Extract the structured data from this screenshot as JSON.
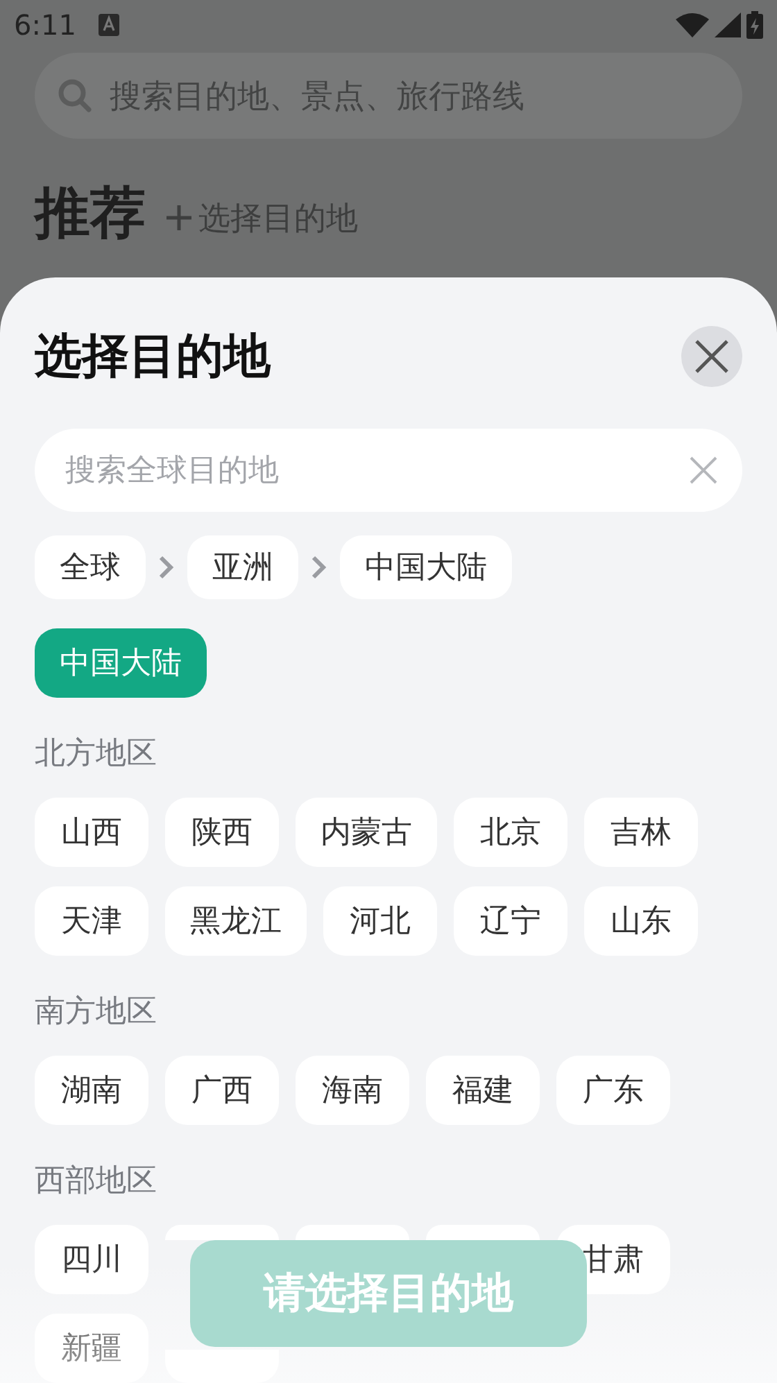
{
  "status_bar": {
    "time": "6:11"
  },
  "background_page": {
    "search": {
      "placeholder": "搜索目的地、景点、旅行路线"
    },
    "title": "推荐",
    "add_link": "选择目的地"
  },
  "sheet": {
    "title": "选择目的地",
    "search": {
      "placeholder": "搜索全球目的地"
    },
    "breadcrumb": [
      "全球",
      "亚洲",
      "中国大陆"
    ],
    "chosen": [
      {
        "label": "中国大陆",
        "selected": true
      }
    ],
    "regions": [
      {
        "title": "北方地区",
        "places": [
          {
            "kind": "place",
            "label": "山西",
            "selected": false
          },
          {
            "kind": "place",
            "label": "陕西",
            "selected": false
          },
          {
            "kind": "place",
            "label": "内蒙古",
            "selected": false
          },
          {
            "kind": "place",
            "label": "北京",
            "selected": false
          },
          {
            "kind": "place",
            "label": "吉林",
            "selected": false
          },
          {
            "kind": "place",
            "label": "天津",
            "selected": false
          },
          {
            "kind": "place",
            "label": "黑龙江",
            "selected": false
          },
          {
            "kind": "place",
            "label": "河北",
            "selected": false
          },
          {
            "kind": "place",
            "label": "辽宁",
            "selected": false
          },
          {
            "kind": "place",
            "label": "山东",
            "selected": false
          }
        ]
      },
      {
        "title": "南方地区",
        "places": [
          {
            "kind": "place",
            "label": "湖南",
            "selected": false
          },
          {
            "kind": "place",
            "label": "广西",
            "selected": false
          },
          {
            "kind": "place",
            "label": "海南",
            "selected": false
          },
          {
            "kind": "place",
            "label": "福建",
            "selected": false
          },
          {
            "kind": "place",
            "label": "广东",
            "selected": false
          }
        ]
      },
      {
        "title": "西部地区",
        "places": [
          {
            "kind": "place",
            "label": "四川",
            "selected": false
          },
          {
            "kind": "covered"
          },
          {
            "kind": "covered"
          },
          {
            "kind": "covered"
          },
          {
            "kind": "place",
            "label": "甘肃",
            "selected": false
          },
          {
            "kind": "place",
            "label": "新疆",
            "selected": false
          },
          {
            "kind": "underneath"
          }
        ]
      }
    ],
    "confirm_button": {
      "label": "请选择目的地",
      "disabled": true
    }
  }
}
